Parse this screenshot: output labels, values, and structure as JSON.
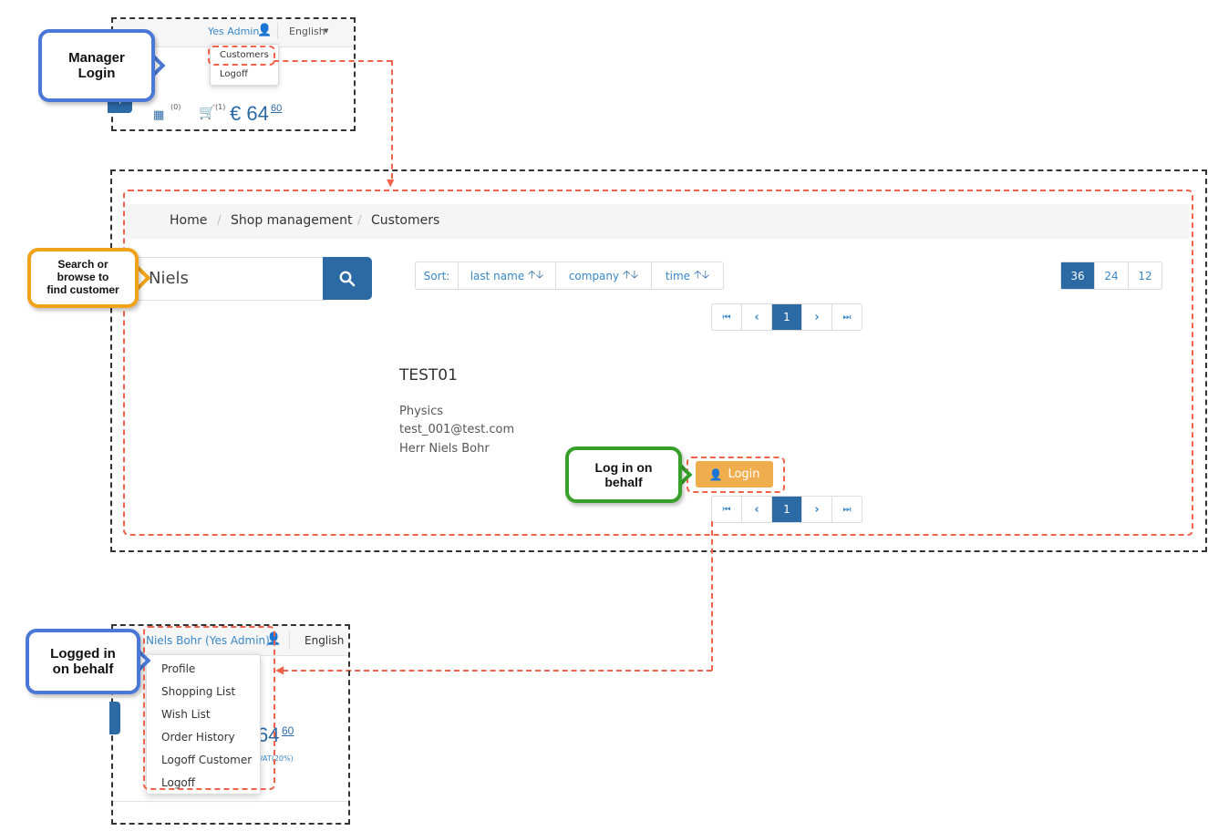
{
  "callouts": {
    "manager_login": [
      "Manager",
      "Login"
    ],
    "search": [
      "Search or",
      "browse to",
      "find customer"
    ],
    "login_behalf": [
      "Log in on",
      "behalf"
    ],
    "logged_in": [
      "Logged in",
      "on behalf"
    ]
  },
  "top_panel": {
    "user_link": "Yes Admin",
    "language": "English",
    "menu": [
      "Customers",
      "Logoff"
    ],
    "wishlist_count": "(0)",
    "cart_count": "(1)",
    "price_main": "€ 64",
    "price_cents": "60"
  },
  "customers_panel": {
    "breadcrumb": [
      "Home",
      "Shop management",
      "Customers"
    ],
    "search_value": "Niels",
    "sort_label": "Sort:",
    "sort_options": [
      "last name",
      "company",
      "time"
    ],
    "page_sizes": [
      "36",
      "24",
      "12"
    ],
    "active_page_size": "36",
    "pagination_current": "1",
    "customer": {
      "id": "TEST01",
      "company": "Physics",
      "email": "test_001@test.com",
      "name": "Herr Niels Bohr"
    },
    "login_button": "Login"
  },
  "bottom_panel": {
    "user_link": "Niels Bohr (Yes Admin)",
    "language": "English",
    "menu": [
      "Profile",
      "Shopping List",
      "Wish List",
      "Order History",
      "Logoff Customer",
      "Logoff"
    ],
    "price_main": "64",
    "price_cents": "60",
    "vat_text": "VAT(20%)"
  },
  "colors": {
    "primary": "#2c6aa6",
    "link": "#3a87c7",
    "login_button": "#f0ad4e",
    "dashed_red": "#f0634a",
    "callout_blue": "#4a78d6",
    "callout_orange": "#f0a21a",
    "callout_green": "#37a02a"
  }
}
